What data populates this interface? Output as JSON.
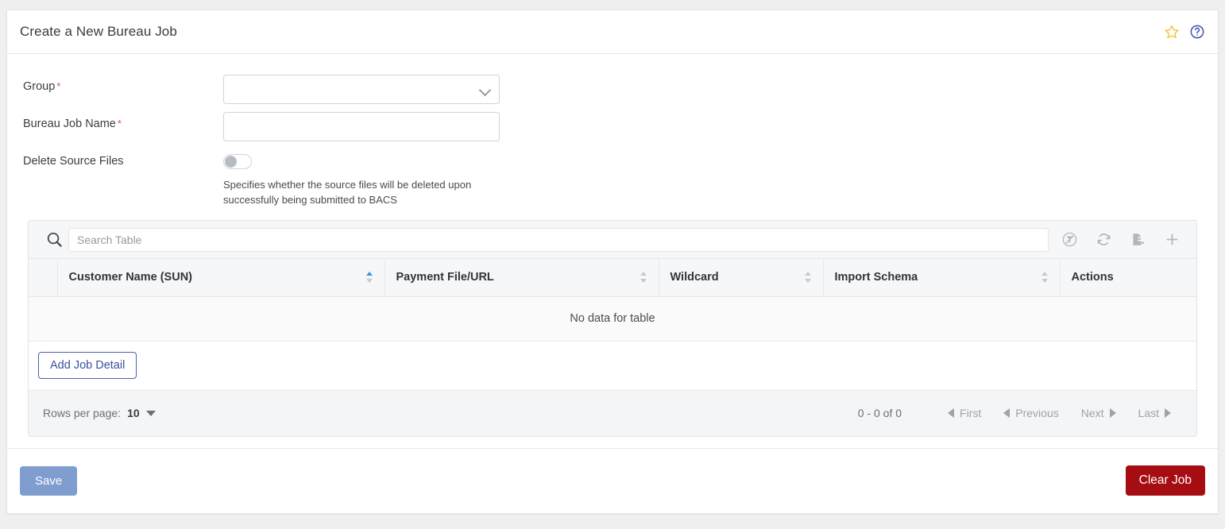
{
  "header": {
    "title": "Create a New Bureau Job",
    "favourite_icon": "star-icon",
    "help_icon": "help-circle-icon"
  },
  "form": {
    "group": {
      "label": "Group",
      "required_marker": "*",
      "value": "",
      "icon": "chevron-down-icon"
    },
    "bureau_job_name": {
      "label": "Bureau Job Name",
      "required_marker": "*",
      "value": "",
      "placeholder": ""
    },
    "delete_source_files": {
      "label": "Delete Source Files",
      "state": "off",
      "help_text": "Specifies whether the source files will be deleted upon successfully being submitted to BACS"
    }
  },
  "table": {
    "search": {
      "icon": "search-icon",
      "value": "",
      "placeholder": "Search Table"
    },
    "toolbar_actions": [
      {
        "name": "clear-filter-icon",
        "title": "Clear Filter"
      },
      {
        "name": "refresh-icon",
        "title": "Refresh"
      },
      {
        "name": "export-icon",
        "title": "Export"
      },
      {
        "name": "add-icon",
        "title": "Add"
      }
    ],
    "columns": [
      {
        "label": "Customer Name (SUN)",
        "sortable": true,
        "sorted": "asc"
      },
      {
        "label": "Payment File/URL",
        "sortable": true,
        "sorted": "none"
      },
      {
        "label": "Wildcard",
        "sortable": true,
        "sorted": "none"
      },
      {
        "label": "Import Schema",
        "sortable": true,
        "sorted": "none"
      },
      {
        "label": "Actions",
        "sortable": false,
        "sorted": "none"
      }
    ],
    "rows": [],
    "empty_message": "No data for table",
    "add_detail_label": "Add Job Detail",
    "pagination": {
      "rows_per_page_label": "Rows per page:",
      "rows_per_page_value": "10",
      "range": "0 - 0 of 0",
      "first": "First",
      "previous": "Previous",
      "next": "Next",
      "last": "Last"
    }
  },
  "footer": {
    "save_label": "Save",
    "clear_label": "Clear Job"
  },
  "colors": {
    "save_button": "#7f9dce",
    "clear_button": "#a50d12",
    "required_marker": "#d9534f",
    "sort_active": "#3d8ee8",
    "link_button": "#37529b",
    "star_icon": "#f5c542",
    "help_icon": "#3b50b5"
  }
}
